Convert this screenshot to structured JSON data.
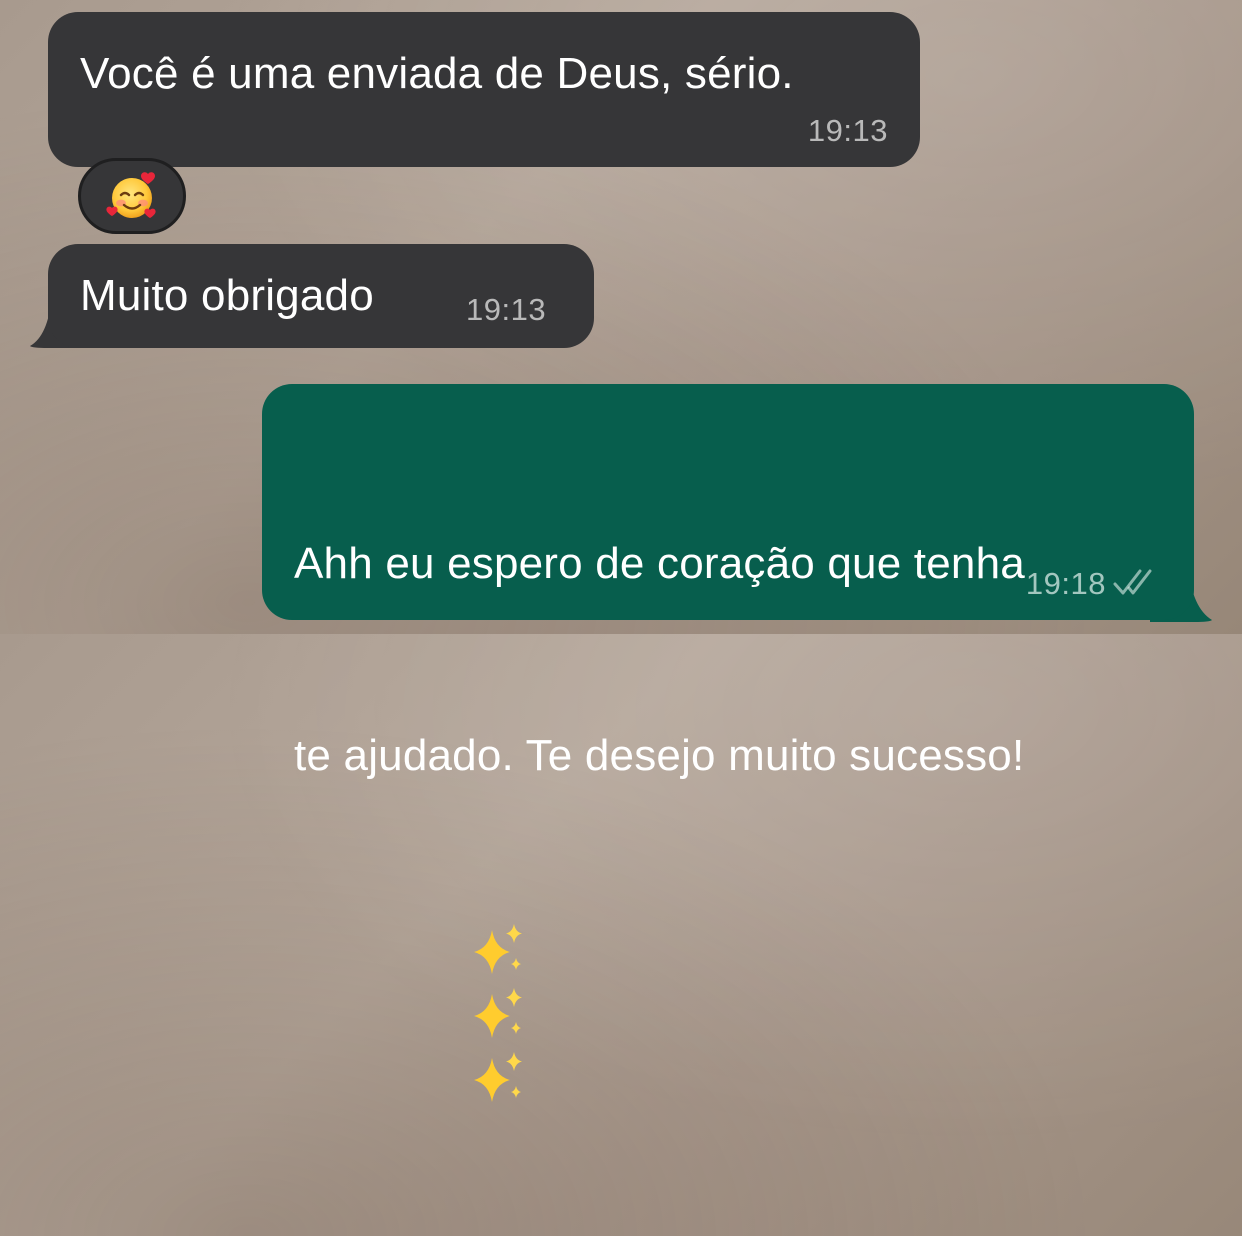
{
  "messages": [
    {
      "direction": "incoming",
      "text": "Você é uma enviada de Deus, sério.",
      "time": "19:13",
      "reaction": "smiling-face-with-hearts-emoji"
    },
    {
      "direction": "incoming",
      "text": "Muito obrigado",
      "time": "19:13"
    },
    {
      "direction": "outgoing",
      "text_line1": "Ahh eu espero de coração que tenha",
      "text_line2": "te ajudado. Te desejo muito sucesso!",
      "emojis": [
        "sparkles-emoji",
        "sparkles-emoji",
        "sparkles-emoji"
      ],
      "time": "19:18",
      "status": "read-double-check-icon"
    }
  ],
  "colors": {
    "incoming_bubble": "#363638",
    "outgoing_bubble": "#075e4d",
    "wallpaper": "#b3a599"
  }
}
